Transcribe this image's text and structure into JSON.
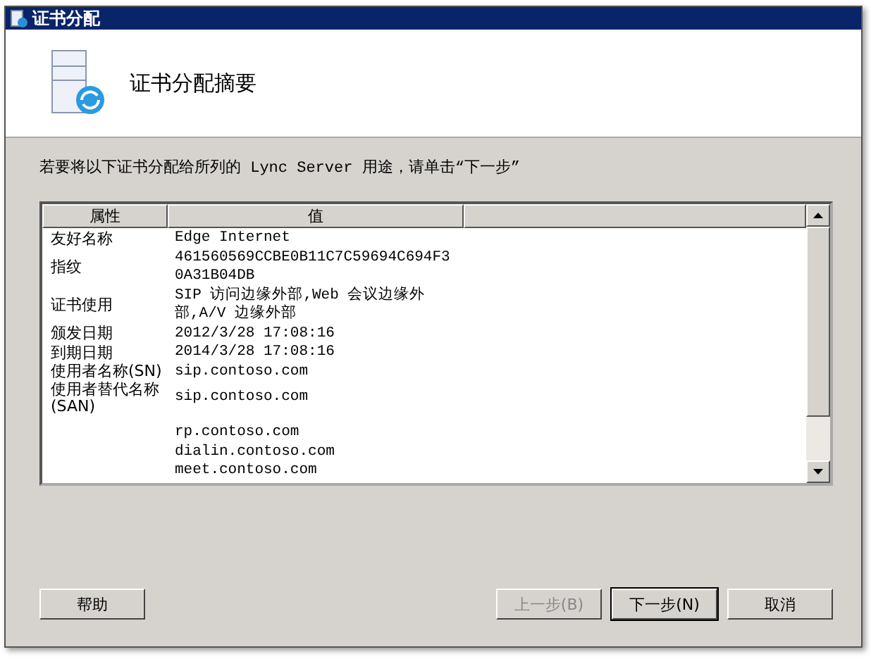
{
  "window": {
    "title": "证书分配"
  },
  "header": {
    "title": "证书分配摘要"
  },
  "instruction": "若要将以下证书分配给所列的 Lync Server 用途，请单击“下一步”",
  "table": {
    "columns": [
      "属性",
      "值"
    ],
    "rows": [
      {
        "property": "友好名称",
        "value_lines": [
          "Edge Internet"
        ]
      },
      {
        "property": "指纹",
        "value_lines": [
          "461560569CCBE0B11C7C59694C694F3",
          "0A31B04DB"
        ]
      },
      {
        "property": "证书使用",
        "value_lines": [
          "SIP 访问边缘外部,Web 会议边缘外",
          "部,A/V 边缘外部"
        ]
      },
      {
        "property": "颁发日期",
        "value_lines": [
          "2012/3/28 17:08:16"
        ]
      },
      {
        "property": "到期日期",
        "value_lines": [
          "2014/3/28 17:08:16"
        ]
      },
      {
        "property": "使用者名称(SN)",
        "value_lines": [
          "sip.contoso.com"
        ]
      },
      {
        "property": "使用者替代名称(SAN)",
        "value_lines": [
          "sip.contoso.com"
        ],
        "continuation_lines": [
          "rp.contoso.com",
          "dialin.contoso.com",
          "meet.contoso.com"
        ]
      }
    ]
  },
  "buttons": [
    {
      "label": "帮助",
      "kind": "left",
      "disabled": false,
      "default": false
    },
    {
      "label": "上一步(B)",
      "kind": "right",
      "disabled": true,
      "default": false
    },
    {
      "label": "下一步(N)",
      "kind": "right",
      "disabled": false,
      "default": true
    },
    {
      "label": "取消",
      "kind": "right",
      "disabled": false,
      "default": false
    }
  ]
}
